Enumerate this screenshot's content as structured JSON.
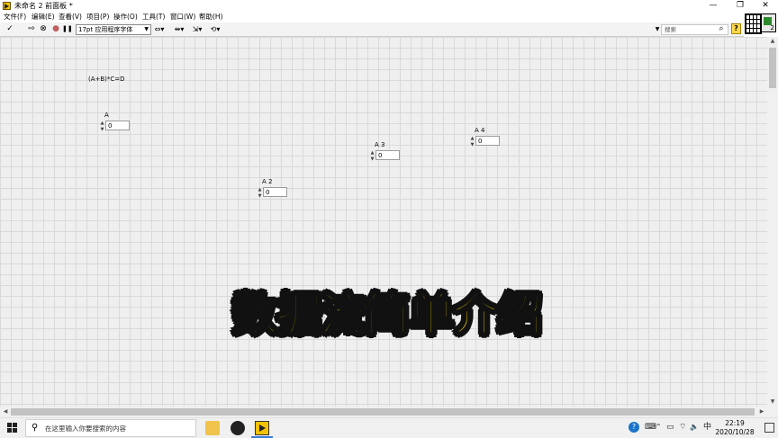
{
  "window": {
    "title": "未命名 2 前面板 *",
    "controls": {
      "minimize": "—",
      "restore": "❐",
      "close": "✕"
    }
  },
  "menu": [
    "文件(F)",
    "编辑(E)",
    "查看(V)",
    "项目(P)",
    "操作(O)",
    "工具(T)",
    "窗口(W)",
    "帮助(H)"
  ],
  "toolbar": {
    "run": "✓",
    "run_continuous": "⇨",
    "abort": "⊗",
    "stop": "●",
    "pause": "❚❚",
    "font_select": "17pt 应用程序字体",
    "align": "⇔▾",
    "distribute": "⇹▾",
    "resize": "⇲▾",
    "reorder": "⟲▾",
    "search_placeholder": "搜索",
    "search_icon": "search-icon",
    "help": "?"
  },
  "canvas": {
    "formula_label": "(A+B)*C=D",
    "controls": [
      {
        "label": "A",
        "value": "0"
      },
      {
        "label": "A 2",
        "value": "0"
      },
      {
        "label": "A 3",
        "value": "0"
      },
      {
        "label": "A 4",
        "value": "0"
      }
    ]
  },
  "caption": "数据流简单介绍",
  "taskbar": {
    "search_placeholder": "在这里输入你要搜索的内容",
    "apps": [
      "file-explorer",
      "obs-studio",
      "labview"
    ],
    "tray": {
      "help": "?",
      "keyboard": "⌨",
      "network": "⌔",
      "volume": "🔈",
      "ime": "中",
      "extra": "⊞"
    },
    "time": "22:19",
    "date": "2020/10/28"
  },
  "colors": {
    "caption_fill": "#ffe000",
    "caption_outline": "#111111",
    "canvas_bg": "#efefef",
    "grid": "#d9d9d9",
    "accent": "#3a7bd5"
  }
}
